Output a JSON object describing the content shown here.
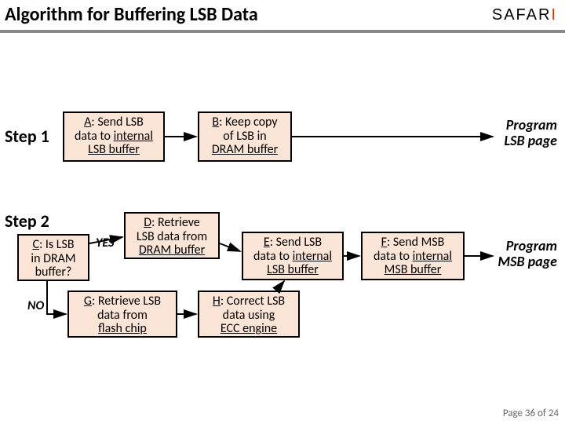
{
  "title": "Algorithm for Buffering LSB Data",
  "brand": {
    "pre": "SAFAR",
    "accent": "I"
  },
  "steps": {
    "s1": "Step 1",
    "s2": "Step 2"
  },
  "boxes": {
    "A": {
      "lbl": "A",
      "rest": ": Send LSB",
      "l2": "data to ",
      "l2b": "internal",
      "l3": "LSB buffer"
    },
    "B": {
      "lbl": "B",
      "rest": ": Keep copy",
      "l2": "of LSB in",
      "l3": "DRAM buffer"
    },
    "C": {
      "lbl": "C",
      "rest": ": Is LSB",
      "l2": "in DRAM",
      "l3": "buffer?"
    },
    "D": {
      "lbl": "D",
      "rest": ": Retrieve",
      "l2": "LSB data from",
      "l3": "DRAM buffer"
    },
    "E": {
      "lbl": "E",
      "rest": ": Send LSB",
      "l2": "data to ",
      "l2b": "internal",
      "l3": "LSB buffer"
    },
    "F": {
      "lbl": "F",
      "rest": ": Send MSB",
      "l2": "data to ",
      "l2b": "internal",
      "l3": "MSB buffer"
    },
    "G": {
      "lbl": "G",
      "rest": ": Retrieve LSB",
      "l2": "data from",
      "l3": "flash chip"
    },
    "H": {
      "lbl": "H",
      "rest": ": Correct LSB",
      "l2": "data using",
      "l3": "ECC engine"
    }
  },
  "edges": {
    "yes": "YES",
    "no": "NO"
  },
  "results": {
    "r1a": "Program",
    "r1b": "LSB page",
    "r2a": "Program",
    "r2b": "MSB page"
  },
  "footer": {
    "pre": "Page ",
    "cur": "36",
    "of": " of ",
    "total": "24"
  }
}
